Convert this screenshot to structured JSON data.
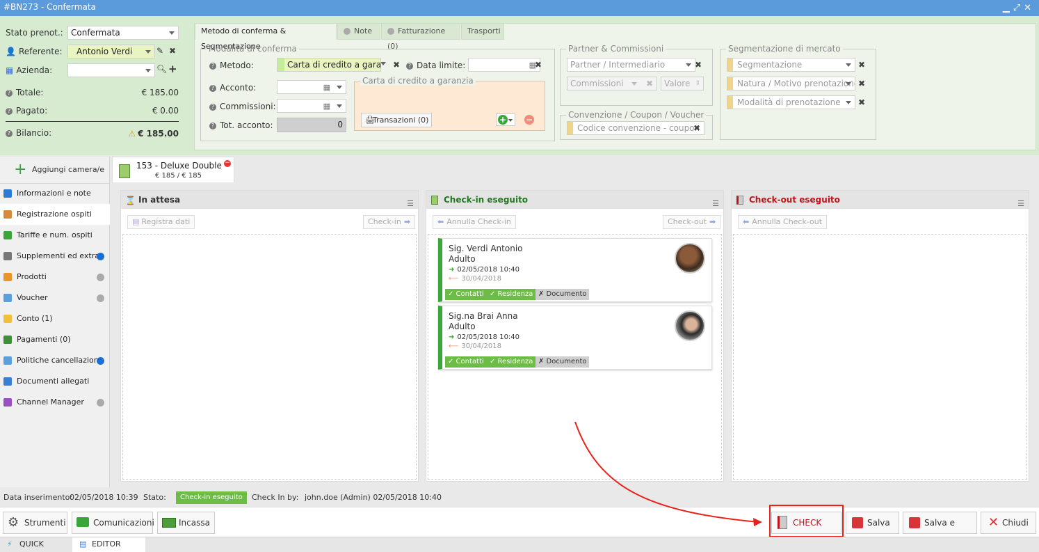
{
  "window": {
    "title": "#BN273 - Confermata",
    "controls": [
      "minimize-icon",
      "maximize-icon",
      "close-icon"
    ]
  },
  "booking": {
    "stato_label": "Stato prenot.:",
    "stato_value": "Confermata",
    "referente_label": "Referente:",
    "referente_value": "Antonio Verdi",
    "azienda_label": "Azienda:",
    "azienda_value": "",
    "totale_label": "Totale:",
    "totale_value": "€ 185.00",
    "pagato_label": "Pagato:",
    "pagato_value": "€ 0.00",
    "bilancio_label": "Bilancio:",
    "bilancio_value": "€ 185.00"
  },
  "tabs": [
    {
      "label": "Metodo di conferma & Segmentazione",
      "active": true
    },
    {
      "label": "Note",
      "active": false
    },
    {
      "label": "Fatturazione (0)",
      "active": false
    },
    {
      "label": "Trasporti",
      "active": false
    }
  ],
  "conferma": {
    "legend": "Modalità di conferma",
    "metodo_label": "Metodo:",
    "metodo_value": "Carta di credito a garanzia",
    "data_limite_label": "Data limite:",
    "data_limite_value": "",
    "acconto_label": "Acconto:",
    "acconto_value": "",
    "commissioni_label": "Commissioni:",
    "commissioni_value": "",
    "tot_acconto_label": "Tot. acconto:",
    "tot_acconto_value": "0",
    "carta_legend": "Carta di credito a garanzia",
    "transazioni_label": "Transazioni (0)"
  },
  "partner": {
    "legend": "Partner & Commissioni",
    "intermediario_placeholder": "Partner / Intermediario",
    "commissioni_placeholder": "Commissioni",
    "valore_placeholder": "Valore"
  },
  "convenzione": {
    "legend": "Convenzione / Coupon / Voucher",
    "codice_placeholder": "Codice convenzione - coupon"
  },
  "segmentazione": {
    "legend": "Segmentazione di mercato",
    "segmentazione_placeholder": "Segmentazione",
    "natura_placeholder": "Natura / Motivo prenotazione",
    "modalita_placeholder": "Modalità di prenotazione"
  },
  "sidebar": {
    "add_room_label": "Aggiungi camera/e",
    "items": [
      {
        "label": "Informazioni e note",
        "icon": "info-icon",
        "dot": ""
      },
      {
        "label": "Registrazione ospiti",
        "icon": "guest-icon",
        "dot": "",
        "active": true
      },
      {
        "label": "Tariffe e num. ospiti",
        "icon": "tag-icon",
        "dot": ""
      },
      {
        "label": "Supplementi ed extra",
        "icon": "bell-icon",
        "dot": "#1a6fd6"
      },
      {
        "label": "Prodotti",
        "icon": "boxes-icon",
        "dot": "#aaaaaa"
      },
      {
        "label": "Voucher",
        "icon": "voucher-icon",
        "dot": "#aaaaaa"
      },
      {
        "label": "Conto (1)",
        "icon": "folder-icon",
        "dot": ""
      },
      {
        "label": "Pagamenti (0)",
        "icon": "money-icon",
        "dot": ""
      },
      {
        "label": "Politiche cancellazione",
        "icon": "document-icon",
        "dot": "#1a6fd6"
      },
      {
        "label": "Documenti allegati",
        "icon": "paperclip-icon",
        "dot": ""
      },
      {
        "label": "Channel Manager",
        "icon": "broadcast-icon",
        "dot": "#aaaaaa"
      }
    ]
  },
  "room_tab": {
    "title": "153 - Deluxe Double",
    "price": "€ 185 / € 185"
  },
  "columns": {
    "waiting": {
      "title": "In attesa",
      "btn_register": "Registra dati",
      "btn_checkin": "Check-in"
    },
    "checked_in": {
      "title": "Check-in eseguito",
      "btn_annulla": "Annulla Check-in",
      "btn_checkout": "Check-out"
    },
    "checked_out": {
      "title": "Check-out eseguito",
      "btn_annulla": "Annulla Check-out"
    }
  },
  "guests": [
    {
      "name": "Sig. Verdi Antonio",
      "type": "Adulto",
      "checkin": "02/05/2018 10:40",
      "checkout": "30/04/2018",
      "tag1": "✓ Contatti",
      "tag2": "✓ Residenza",
      "tag3": "✗ Documento"
    },
    {
      "name": "Sig.na Brai Anna",
      "type": "Adulto",
      "checkin": "02/05/2018 10:40",
      "checkout": "30/04/2018",
      "tag1": "✓ Contatti",
      "tag2": "✓ Residenza",
      "tag3": "✗ Documento"
    }
  ],
  "status_strip": {
    "inserimento_label": "Data inserimento:",
    "inserimento_value": "02/05/2018 10:39",
    "stato_label": "Stato:",
    "stato_badge": "Check-in eseguito",
    "checkin_by_label": "Check In by:",
    "checkin_by_value": "john.doe (Admin) 02/05/2018 10:40"
  },
  "toolbar": {
    "strumenti": "Strumenti",
    "comunicazioni": "Comunicazioni",
    "incassa": "Incassa",
    "check_out": "CHECK OUT",
    "salva": "Salva",
    "salva_chiudi": "Salva e chiudi",
    "chiudi": "Chiudi"
  },
  "views": {
    "quick": "QUICK VIEW",
    "editor": "EDITOR VIEW"
  },
  "colors": {
    "titlebar": "#5b9bdc",
    "header_green": "#d6ebd0",
    "checkin_green": "#1f7a1f",
    "checkout_red": "#c0141c",
    "highlight_red": "#e8221a"
  }
}
